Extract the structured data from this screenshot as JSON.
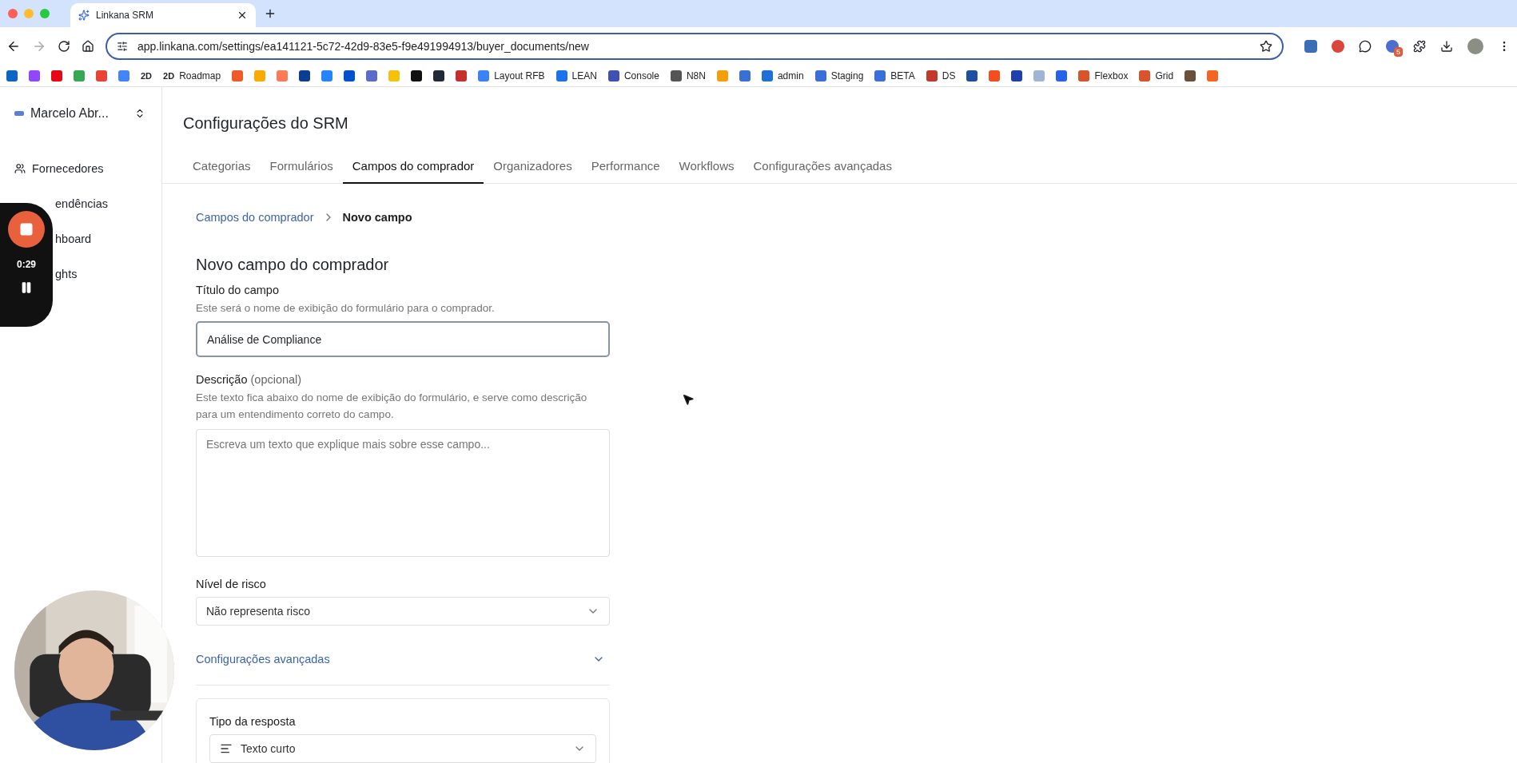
{
  "browser": {
    "tab_title": "Linkana SRM",
    "url": "app.linkana.com/settings/ea141121-5c72-42d9-83e5-f9e491994913/buyer_documents/new",
    "extension_badge": "5",
    "bookmarks": [
      {
        "kind": "icon",
        "color": "#0a66c2"
      },
      {
        "kind": "icon",
        "color": "#9146ff"
      },
      {
        "kind": "icon",
        "color": "#e50914"
      },
      {
        "kind": "icon",
        "color": "#34a853"
      },
      {
        "kind": "icon",
        "color": "#ea4335"
      },
      {
        "kind": "icon",
        "color": "#4285f4"
      },
      {
        "kind": "glyph",
        "glyph": "2D"
      },
      {
        "kind": "glyph",
        "glyph": "2D",
        "label": "Roadmap"
      },
      {
        "kind": "icon",
        "color": "#f05a28"
      },
      {
        "kind": "icon",
        "color": "#f9ab00"
      },
      {
        "kind": "icon",
        "color": "#ff7a59"
      },
      {
        "kind": "icon",
        "color": "#0b3d91"
      },
      {
        "kind": "icon",
        "color": "#2684ff"
      },
      {
        "kind": "icon",
        "color": "#0052cc"
      },
      {
        "kind": "icon",
        "color": "#5b6dc8"
      },
      {
        "kind": "icon",
        "color": "#f4c20d"
      },
      {
        "kind": "icon",
        "color": "#111111"
      },
      {
        "kind": "icon",
        "color": "#1f2937"
      },
      {
        "kind": "icon",
        "color": "#c4302b"
      },
      {
        "kind": "icon",
        "color": "#3b82f6",
        "label": "Layout RFB"
      },
      {
        "kind": "icon",
        "color": "#1a73e8",
        "label": "LEAN"
      },
      {
        "kind": "icon",
        "color": "#3f51b5",
        "label": "Console"
      },
      {
        "kind": "icon",
        "color": "#555555",
        "label": "N8N"
      },
      {
        "kind": "icon",
        "color": "#f59e0b"
      },
      {
        "kind": "icon",
        "color": "#3b6fd8"
      },
      {
        "kind": "icon",
        "color": "#1e6fd9",
        "label": "admin"
      },
      {
        "kind": "icon",
        "color": "#3b6fd8",
        "label": "Staging"
      },
      {
        "kind": "icon",
        "color": "#3b6fd8",
        "label": "BETA"
      },
      {
        "kind": "icon",
        "color": "#c0392b",
        "label": "DS"
      },
      {
        "kind": "icon",
        "color": "#1f4fa3"
      },
      {
        "kind": "icon",
        "color": "#f24e1e"
      },
      {
        "kind": "icon",
        "color": "#1e40af"
      },
      {
        "kind": "icon",
        "color": "#9fb4d6"
      },
      {
        "kind": "icon",
        "color": "#2563eb"
      },
      {
        "kind": "icon",
        "color": "#d9532c",
        "label": "Flexbox"
      },
      {
        "kind": "icon",
        "color": "#d9532c",
        "label": "Grid"
      },
      {
        "kind": "icon",
        "color": "#6b4f3a"
      },
      {
        "kind": "icon",
        "color": "#f26522"
      }
    ]
  },
  "sidebar": {
    "account": "Marcelo Abr...",
    "items": [
      {
        "kind": "full",
        "label": "Fornecedores"
      },
      {
        "kind": "covered",
        "label": "endências"
      },
      {
        "kind": "covered",
        "label": "hboard"
      },
      {
        "kind": "covered",
        "label": "ghts"
      }
    ]
  },
  "recorder": {
    "time": "0:29"
  },
  "page": {
    "title": "Configurações do SRM",
    "tabs": [
      {
        "label": "Categorias",
        "selected": false
      },
      {
        "label": "Formulários",
        "selected": false
      },
      {
        "label": "Campos do comprador",
        "selected": true
      },
      {
        "label": "Organizadores",
        "selected": false
      },
      {
        "label": "Performance",
        "selected": false
      },
      {
        "label": "Workflows",
        "selected": false
      },
      {
        "label": "Configurações avançadas",
        "selected": false
      }
    ],
    "breadcrumb": [
      {
        "label": "Campos do comprador",
        "link": true
      },
      {
        "label": "Novo campo",
        "link": false
      }
    ],
    "heading": "Novo campo do comprador",
    "title_field": {
      "label": "Título do campo",
      "hint": "Este será o nome de exibição do formulário para o comprador.",
      "value": "Análise de Compliance",
      "focused": true
    },
    "description": {
      "label": "Descrição",
      "optional": "(opcional)",
      "hint": "Este texto fica abaixo do nome de exibição do formulário, e serve como descrição para um entendimento correto do campo.",
      "placeholder": "Escreva um texto que explique mais sobre esse campo..."
    },
    "risk": {
      "label": "Nível de risco",
      "value": "Não representa risco"
    },
    "advanced": {
      "label": "Configurações avançadas"
    },
    "response_type": {
      "label": "Tipo da resposta",
      "value": "Texto curto"
    }
  }
}
